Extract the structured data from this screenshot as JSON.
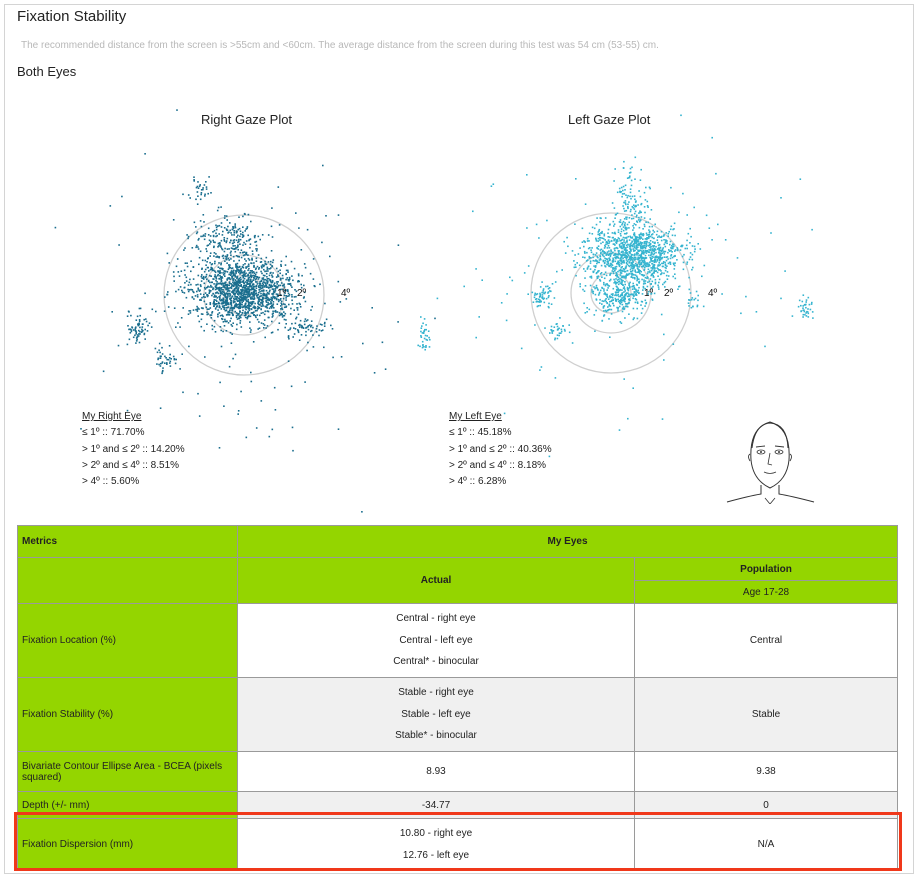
{
  "page": {
    "title": "Fixation Stability",
    "note": "The recommended distance from the screen is >55cm and <60cm. The average distance from the screen during this test was 54 cm (53-55) cm.",
    "subtitle": "Both Eyes"
  },
  "right_plot": {
    "title": "Right Gaze Plot",
    "rings": [
      "1º",
      "2º",
      "4º"
    ],
    "dot_color": "#1a6e8e",
    "stats_title": "My Right Eye",
    "stats": [
      "≤ 1º :: 71.70%",
      "> 1º and ≤ 2º :: 14.20%",
      "> 2º and ≤ 4º :: 8.51%",
      "> 4º :: 5.60%"
    ]
  },
  "left_plot": {
    "title": "Left Gaze Plot",
    "rings": [
      "1º",
      "2º",
      "4º"
    ],
    "dot_color": "#35b4cf",
    "stats_title": "My Left Eye",
    "stats": [
      "≤ 1º :: 45.18%",
      "> 1º and ≤ 2º :: 40.36%",
      "> 2º and ≤ 4º :: 8.18%",
      "> 4º :: 6.28%"
    ]
  },
  "table": {
    "col_metrics": "Metrics",
    "col_my_eyes": "My Eyes",
    "col_actual": "Actual",
    "col_population": "Population",
    "col_age": "Age 17-28",
    "rows": [
      {
        "label": "Fixation Location (%)",
        "actual": [
          "Central - right eye",
          "Central - left eye",
          "Central* - binocular"
        ],
        "population": "Central"
      },
      {
        "label": "Fixation Stability (%)",
        "actual": [
          "Stable - right eye",
          "Stable - left eye",
          "Stable* - binocular"
        ],
        "population": "Stable"
      },
      {
        "label": "Bivariate Contour Ellipse Area - BCEA (pixels squared)",
        "actual": [
          "8.93"
        ],
        "population": "9.38"
      },
      {
        "label": "Depth (+/- mm)",
        "actual": [
          "-34.77"
        ],
        "population": "0"
      },
      {
        "label": "Fixation Dispersion (mm)",
        "actual": [
          "10.80 - right eye",
          "12.76 - left eye"
        ],
        "population": "N/A"
      }
    ]
  },
  "colors": {
    "header_green": "#94d500",
    "highlight_red": "#f0381a"
  }
}
